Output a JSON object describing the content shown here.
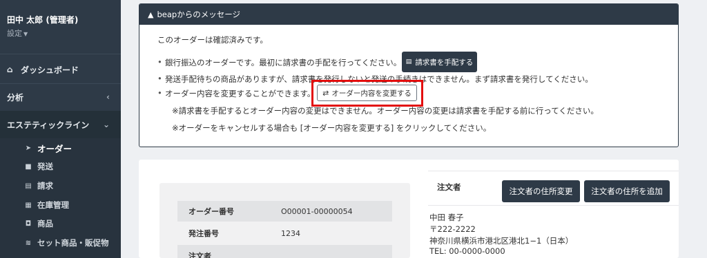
{
  "sidebar": {
    "user_name": "田中 太郎 (管理者)",
    "settings_label": "設定",
    "nav": {
      "dashboard": "ダッシュボード",
      "analytics": "分析",
      "group": "エステティックライン"
    },
    "sub_items": [
      {
        "label": "オーダー",
        "icon": "paper-plane-icon",
        "active": true
      },
      {
        "label": "発送",
        "icon": "truck-icon"
      },
      {
        "label": "請求",
        "icon": "document-icon"
      },
      {
        "label": "在庫管理",
        "icon": "inventory-icon"
      },
      {
        "label": "商品",
        "icon": "shopping-bag-icon"
      },
      {
        "label": "セット商品・販促物",
        "icon": "layers-icon"
      }
    ]
  },
  "message": {
    "title": "beapからのメッセージ",
    "confirmed": "このオーダーは確認済みです。",
    "bank_transfer": "銀行振込のオーダーです。最初に請求書の手配を行ってください。",
    "invoice_button": "請求書を手配する",
    "pending_shipping": "発送手配待ちの商品がありますが、請求書を発行しないと発送の手続きはできません。まず請求書を発行してください。",
    "can_change": "オーダー内容を変更することができます。",
    "change_button": "オーダー内容を変更する",
    "note_1": "※請求書を手配するとオーダー内容の変更はできません。オーダー内容の変更は請求書を手配する前に行ってください。",
    "note_2": "※オーダーをキャンセルする場合も [オーダー内容を変更する] をクリックしてください。"
  },
  "order": {
    "rows": [
      {
        "key": "オーダー番号",
        "value": "O00001-00000054"
      },
      {
        "key": "発注番号",
        "value": "1234"
      },
      {
        "key": "注文者",
        "value": ""
      }
    ],
    "orderer_title": "注文者",
    "change_address_button": "注文者の住所変更",
    "add_address_button": "注文者の住所を追加",
    "address": {
      "name": "中田 春子",
      "postal": "〒222-2222",
      "street": "神奈川県横浜市港北区港北1−1（日本）",
      "tel": "TEL: 00-0000-0000"
    }
  },
  "colors": {
    "sidebar": "#2e3a47",
    "accent_dark": "#2e3a47",
    "highlight": "#e30d0d"
  }
}
